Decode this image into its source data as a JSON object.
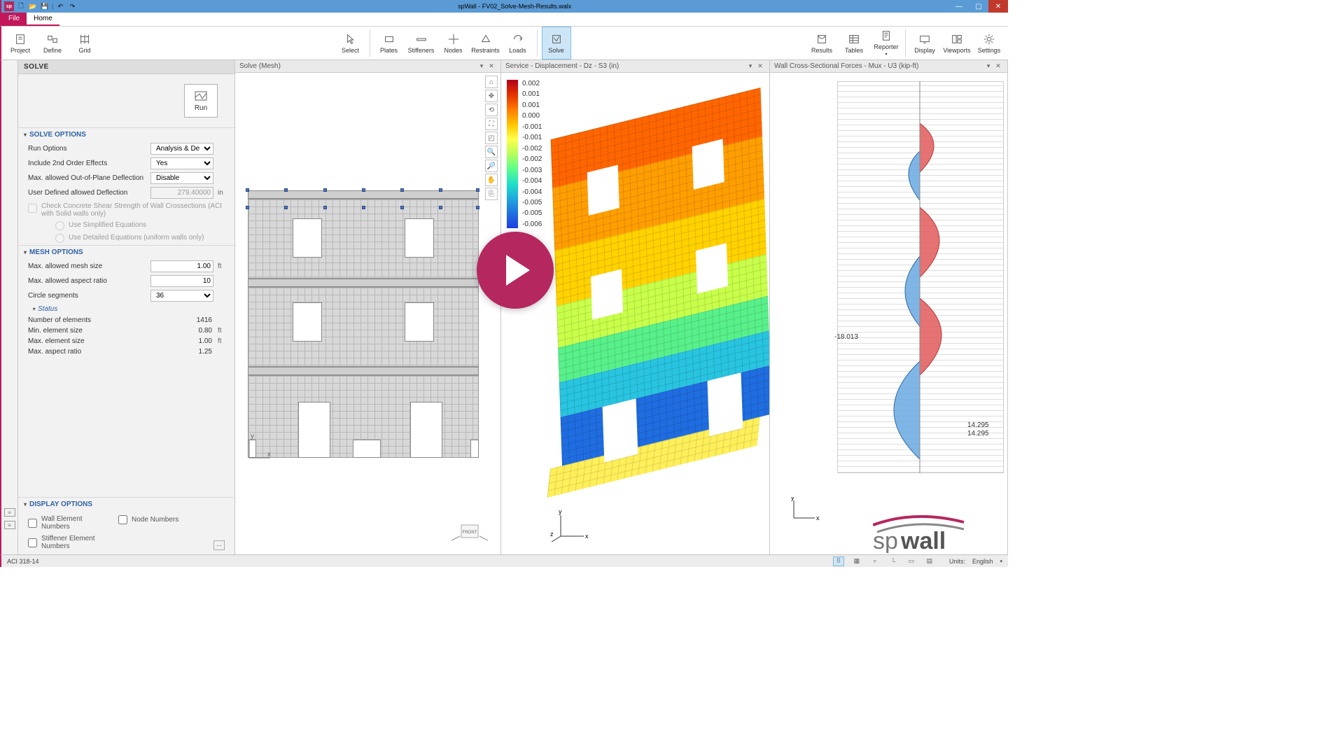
{
  "app": {
    "title": "spWall - FV02_Solve-Mesh-Results.walx",
    "brand": "spwall"
  },
  "menutabs": {
    "file": "File",
    "home": "Home"
  },
  "ribbon": {
    "project": "Project",
    "define": "Define",
    "grid": "Grid",
    "select": "Select",
    "plates": "Plates",
    "stiffeners": "Stiffeners",
    "nodes": "Nodes",
    "restraints": "Restraints",
    "loads": "Loads",
    "solve": "Solve",
    "results": "Results",
    "tables": "Tables",
    "reporter": "Reporter",
    "display": "Display",
    "viewports": "Viewports",
    "settings": "Settings"
  },
  "panel": {
    "title": "SOLVE",
    "run": "Run",
    "solve_options": "SOLVE OPTIONS",
    "run_options_lbl": "Run Options",
    "run_options_val": "Analysis & Design",
    "include_2nd_lbl": "Include 2nd Order Effects",
    "include_2nd_val": "Yes",
    "max_defl_lbl": "Max. allowed Out-of-Plane Deflection",
    "max_defl_val": "Disable",
    "user_defl_lbl": "User Defined allowed Deflection",
    "user_defl_val": "279.40000",
    "user_defl_unit": "in",
    "chk_concrete": "Check Concrete Shear Strength of Wall Crossections (ACI with Solid walls only)",
    "chk_simple": "Use Simplified Equations",
    "chk_detailed": "Use Detailed Equations (uniform walls only)",
    "mesh_options": "MESH OPTIONS",
    "mesh_size_lbl": "Max. allowed mesh size",
    "mesh_size_val": "1.00",
    "aspect_lbl": "Max. allowed aspect ratio",
    "aspect_val": "10",
    "circle_lbl": "Circle segments",
    "circle_val": "36",
    "status": "Status",
    "num_elem_lbl": "Number of elements",
    "num_elem_val": "1416",
    "min_elem_lbl": "Min. element size",
    "min_elem_val": "0.80",
    "max_elem_lbl": "Max. element size",
    "max_elem_val": "1.00",
    "max_asp_lbl": "Max. aspect ratio",
    "max_asp_val": "1.25",
    "ft": "ft",
    "display_options": "DISPLAY OPTIONS",
    "wall_num": "Wall Element Numbers",
    "node_num": "Node Numbers",
    "stiff_num": "Stiffener Element Numbers"
  },
  "views": {
    "mesh": {
      "title": "Solve (Mesh)",
      "front": "FRONT",
      "x": "x",
      "y": "y"
    },
    "contour": {
      "title": "Service - Displacement - Dz - S3 (in)",
      "legend": [
        "0.002",
        "0.001",
        "0.001",
        "0.000",
        "-0.001",
        "-0.001",
        "-0.002",
        "-0.002",
        "-0.003",
        "-0.004",
        "-0.004",
        "-0.005",
        "-0.005",
        "-0.006"
      ],
      "x": "x",
      "y": "y",
      "z": "z"
    },
    "forces": {
      "title": "Wall Cross-Sectional Forces - Mux - U3 (kip-ft)",
      "v1": "-18.013",
      "v2": "14.295",
      "v3": "14.295",
      "x": "x",
      "y": "y"
    }
  },
  "statusbar": {
    "code": "ACI 318-14",
    "units_lbl": "Units:",
    "units_val": "English"
  },
  "chart_data": {
    "type": "contour-legend",
    "title": "Service - Displacement - Dz - S3 (in)",
    "values": [
      0.002,
      0.001,
      0.001,
      0.0,
      -0.001,
      -0.001,
      -0.002,
      -0.002,
      -0.003,
      -0.004,
      -0.004,
      -0.005,
      -0.005,
      -0.006
    ]
  }
}
